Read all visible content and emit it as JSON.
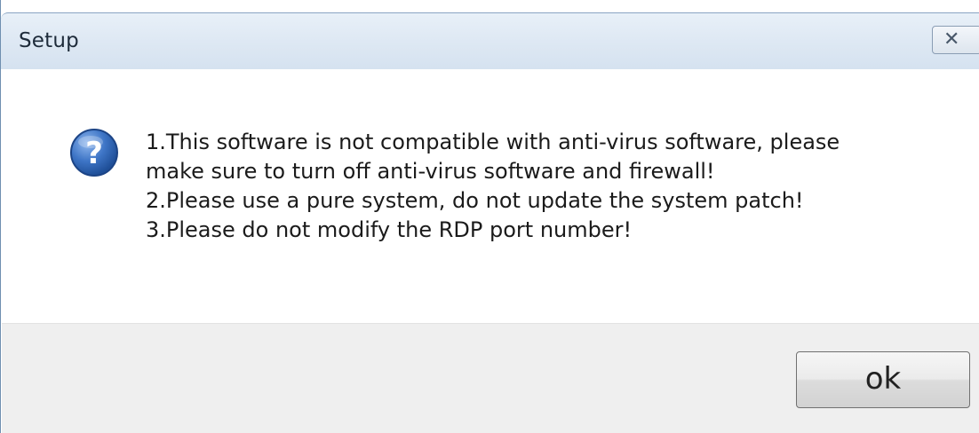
{
  "window": {
    "title": "Setup",
    "close_icon": "close-icon"
  },
  "dialog": {
    "icon": "question-icon",
    "lines": [
      "1.This software is not compatible with anti-virus software, please",
      "make sure to turn off anti-virus software and firewall!",
      "2.Please use a pure system, do not update the system patch!",
      "3.Please do not modify the RDP port number!"
    ]
  },
  "footer": {
    "ok_label": "ok"
  },
  "colors": {
    "titlebar": "#dfe9f4",
    "icon_blue": "#2f66b3",
    "footer": "#efefef"
  }
}
